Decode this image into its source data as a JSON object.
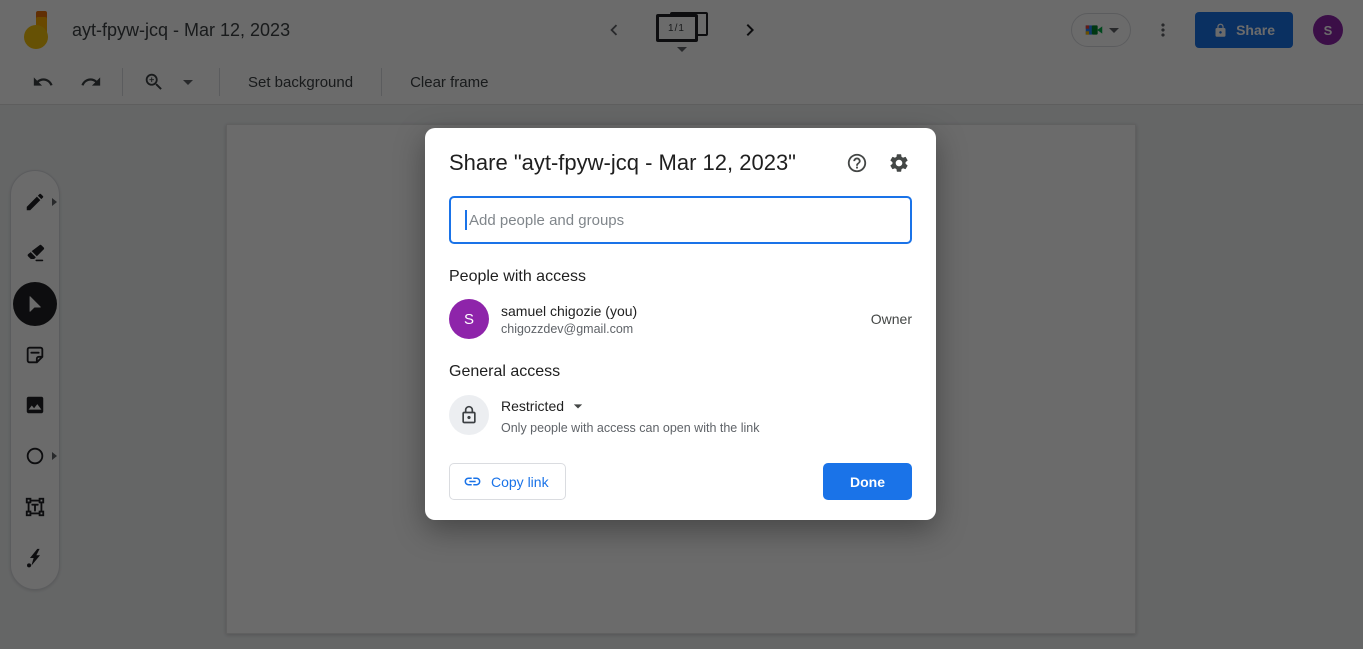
{
  "app": {
    "title": "ayt-fpyw-jcq - Mar 12, 2023",
    "frame_indicator": "1/1",
    "share_label": "Share",
    "avatar_letter": "S"
  },
  "toolbar": {
    "set_background_label": "Set background",
    "clear_frame_label": "Clear frame"
  },
  "sidebar": {
    "tools": [
      {
        "name": "pen",
        "active": false,
        "has_flyout": true
      },
      {
        "name": "eraser",
        "active": false
      },
      {
        "name": "select",
        "active": true
      },
      {
        "name": "sticky-note",
        "active": false
      },
      {
        "name": "image",
        "active": false
      },
      {
        "name": "shape",
        "active": false,
        "has_flyout": true
      },
      {
        "name": "text-box",
        "active": false
      },
      {
        "name": "laser",
        "active": false
      }
    ]
  },
  "dialog": {
    "title": "Share \"ayt-fpyw-jcq - Mar 12, 2023\"",
    "input_placeholder": "Add people and groups",
    "people_heading": "People with access",
    "people": [
      {
        "avatar_letter": "S",
        "name": "samuel chigozie (you)",
        "email": "chigozzdev@gmail.com",
        "role": "Owner"
      }
    ],
    "general_heading": "General access",
    "access_level": "Restricted",
    "access_description": "Only people with access can open with the link",
    "copy_link_label": "Copy link",
    "done_label": "Done"
  },
  "icons": {
    "undo": "curved-arrow-left",
    "redo": "curved-arrow-right",
    "zoom": "magnifier-plus",
    "frames": "stacked-frames",
    "meet": "video-camera",
    "more": "kebab-dots",
    "share_lock": "padlock",
    "help": "question-circle",
    "settings": "gear",
    "general_access": "padlock-outline",
    "copy_link": "chain-link"
  },
  "colors": {
    "accent_blue": "#1a73e8",
    "avatar_purple": "#8e24aa",
    "logo_yellow": "#f4c20d",
    "logo_orange": "#f9ab00",
    "overlay": "rgba(0,0,0,0.58)"
  }
}
